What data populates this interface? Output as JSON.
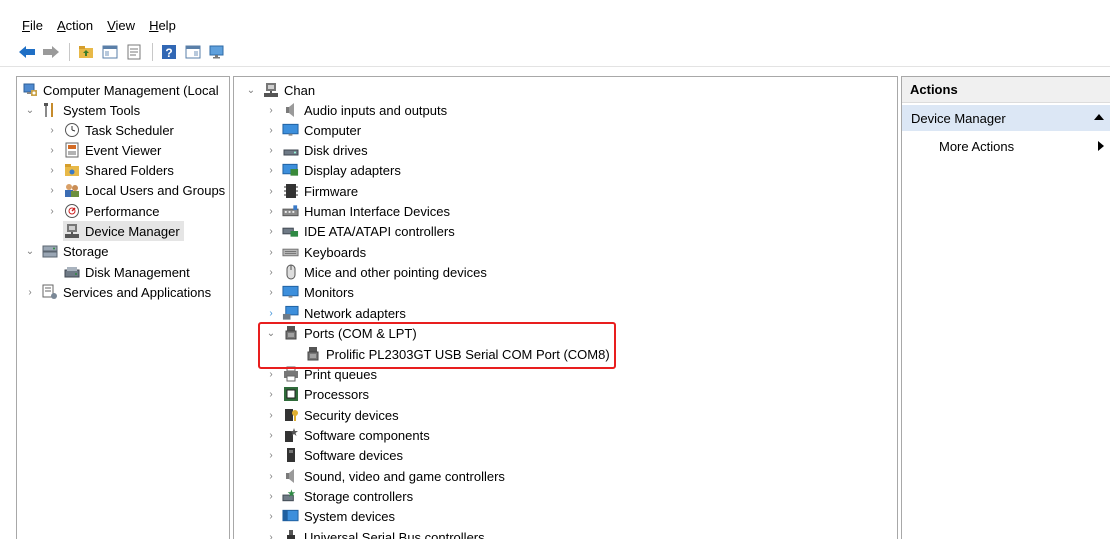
{
  "menu": [
    {
      "label": "File",
      "underline": "F",
      "rest": "ile"
    },
    {
      "label": "Action",
      "underline": "A",
      "rest": "ction"
    },
    {
      "label": "View",
      "underline": "V",
      "rest": "iew"
    },
    {
      "label": "Help",
      "underline": "H",
      "rest": "elp"
    }
  ],
  "left_tree": [
    {
      "label": "Computer Management (Local",
      "icon": "computer-management-icon",
      "level": 0,
      "expander": "none"
    },
    {
      "label": "System Tools",
      "icon": "tools-icon",
      "level": 1,
      "expander": "expanded"
    },
    {
      "label": "Task Scheduler",
      "icon": "clock-icon",
      "level": 2,
      "expander": "collapsed"
    },
    {
      "label": "Event Viewer",
      "icon": "event-viewer-icon",
      "level": 2,
      "expander": "collapsed"
    },
    {
      "label": "Shared Folders",
      "icon": "shared-folder-icon",
      "level": 2,
      "expander": "collapsed"
    },
    {
      "label": "Local Users and Groups",
      "icon": "users-icon",
      "level": 2,
      "expander": "collapsed"
    },
    {
      "label": "Performance",
      "icon": "performance-icon",
      "level": 2,
      "expander": "collapsed"
    },
    {
      "label": "Device Manager",
      "icon": "device-manager-icon",
      "level": 2,
      "expander": "none",
      "selected": true
    },
    {
      "label": "Storage",
      "icon": "storage-icon",
      "level": 1,
      "expander": "expanded"
    },
    {
      "label": "Disk Management",
      "icon": "disk-management-icon",
      "level": 2,
      "expander": "none"
    },
    {
      "label": "Services and Applications",
      "icon": "services-icon",
      "level": 1,
      "expander": "collapsed"
    }
  ],
  "device_tree": {
    "root": {
      "label": "Chan",
      "icon": "computer-tree-icon"
    },
    "categories": [
      {
        "label": "Audio inputs and outputs",
        "icon": "speaker-icon"
      },
      {
        "label": "Computer",
        "icon": "monitor-icon"
      },
      {
        "label": "Disk drives",
        "icon": "disk-drive-icon"
      },
      {
        "label": "Display adapters",
        "icon": "display-adapter-icon"
      },
      {
        "label": "Firmware",
        "icon": "firmware-icon"
      },
      {
        "label": "Human Interface Devices",
        "icon": "hid-icon"
      },
      {
        "label": "IDE ATA/ATAPI controllers",
        "icon": "ide-controller-icon"
      },
      {
        "label": "Keyboards",
        "icon": "keyboard-icon"
      },
      {
        "label": "Mice and other pointing devices",
        "icon": "mouse-icon"
      },
      {
        "label": "Monitors",
        "icon": "monitor-icon"
      },
      {
        "label": "Network adapters",
        "icon": "network-adapter-icon"
      },
      {
        "label": "Ports (COM & LPT)",
        "icon": "port-icon",
        "expanded": true
      },
      {
        "label": "Prolific PL2303GT USB Serial COM Port (COM8)",
        "icon": "port-icon",
        "child": true
      },
      {
        "label": "Print queues",
        "icon": "printer-icon"
      },
      {
        "label": "Processors",
        "icon": "processor-icon"
      },
      {
        "label": "Security devices",
        "icon": "security-device-icon"
      },
      {
        "label": "Software components",
        "icon": "software-component-icon"
      },
      {
        "label": "Software devices",
        "icon": "software-device-icon"
      },
      {
        "label": "Sound, video and game controllers",
        "icon": "speaker-icon"
      },
      {
        "label": "Storage controllers",
        "icon": "storage-controller-icon"
      },
      {
        "label": "System devices",
        "icon": "system-devices-icon"
      },
      {
        "label": "Universal Serial Bus controllers",
        "icon": "usb-icon"
      }
    ]
  },
  "actions": {
    "header": "Actions",
    "section": "Device Manager",
    "items": [
      "More Actions"
    ]
  },
  "colors": {
    "highlight_box": "#e81e1e",
    "selected_bg": "#e5e5e5",
    "actions_section_bg": "#dce7f5"
  }
}
